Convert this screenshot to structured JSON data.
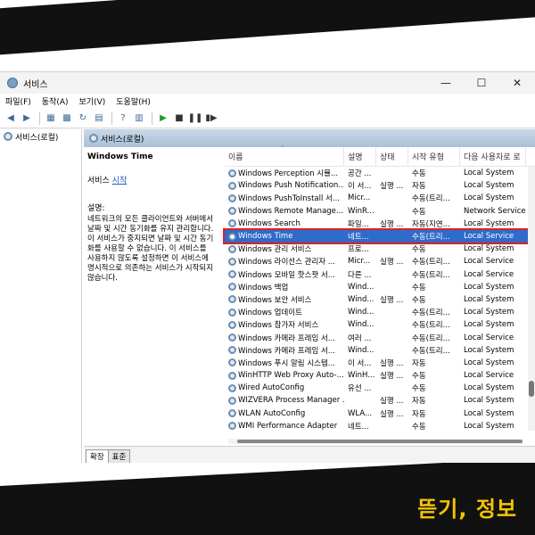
{
  "window": {
    "title": "서비스"
  },
  "menu": [
    "파일(F)",
    "동작(A)",
    "보기(V)",
    "도움말(H)"
  ],
  "tree": {
    "root": "서비스(로컬)"
  },
  "main": {
    "header": "서비스(로컬)"
  },
  "desc": {
    "title": "Windows Time",
    "action_prefix": "서비스 ",
    "action_link": "시작",
    "label": "설명:",
    "body": "네트워크의 모든 클라이언트와 서버에서 날짜 및 시간 동기화를 유지 관리합니다. 이 서비스가 중지되면 날짜 및 시간 동기화를 사용할 수 없습니다. 이 서비스를 사용하지 않도록 설정하면 이 서비스에 명시적으로 의존하는 서비스가 시작되지 않습니다."
  },
  "columns": [
    "이름",
    "설명",
    "상태",
    "시작 유형",
    "다음 사용자로 로"
  ],
  "rows": [
    {
      "name": "Windows Perception 시뮬...",
      "desc": "공간 ...",
      "status": "",
      "start": "수동",
      "logon": "Local System"
    },
    {
      "name": "Windows Push Notification...",
      "desc": "이 서...",
      "status": "실행 ...",
      "start": "자동",
      "logon": "Local System"
    },
    {
      "name": "Windows PushToInstall 서...",
      "desc": "Micr...",
      "status": "",
      "start": "수동(트리...",
      "logon": "Local System"
    },
    {
      "name": "Windows Remote Manage...",
      "desc": "WinR...",
      "status": "",
      "start": "수동",
      "logon": "Network Service"
    },
    {
      "name": "Windows Search",
      "desc": "파일...",
      "status": "실행 ...",
      "start": "자동(지연...",
      "logon": "Local System"
    },
    {
      "name": "Windows Time",
      "desc": "네트...",
      "status": "",
      "start": "수동(트리...",
      "logon": "Local Service",
      "selected": true
    },
    {
      "name": "Windows 관리 서비스",
      "desc": "프로...",
      "status": "",
      "start": "수동",
      "logon": "Local System"
    },
    {
      "name": "Windows 라이선스 관리자 ...",
      "desc": "Micr...",
      "status": "실행 ...",
      "start": "수동(트리...",
      "logon": "Local Service"
    },
    {
      "name": "Windows 모바일 핫스팟 서...",
      "desc": "다른 ...",
      "status": "",
      "start": "수동(트리...",
      "logon": "Local Service"
    },
    {
      "name": "Windows 백업",
      "desc": "Wind...",
      "status": "",
      "start": "수동",
      "logon": "Local System"
    },
    {
      "name": "Windows 보안 서비스",
      "desc": "Wind...",
      "status": "실행 ...",
      "start": "수동",
      "logon": "Local System"
    },
    {
      "name": "Windows 업데이트",
      "desc": "Wind...",
      "status": "",
      "start": "수동(트리...",
      "logon": "Local System"
    },
    {
      "name": "Windows 참가자 서비스",
      "desc": "Wind...",
      "status": "",
      "start": "수동(트리...",
      "logon": "Local System"
    },
    {
      "name": "Windows 카메라 프레임 서...",
      "desc": "여러 ...",
      "status": "",
      "start": "수동(트리...",
      "logon": "Local Service"
    },
    {
      "name": "Windows 카메라 프레임 서...",
      "desc": "Wind...",
      "status": "",
      "start": "수동(트리...",
      "logon": "Local System"
    },
    {
      "name": "Windows 푸시 알림 시스템...",
      "desc": "이 서...",
      "status": "실행 ...",
      "start": "자동",
      "logon": "Local System"
    },
    {
      "name": "WinHTTP Web Proxy Auto-...",
      "desc": "WinH...",
      "status": "실행 ...",
      "start": "수동",
      "logon": "Local Service"
    },
    {
      "name": "Wired AutoConfig",
      "desc": "유선 ...",
      "status": "",
      "start": "수동",
      "logon": "Local System"
    },
    {
      "name": "WIZVERA Process Manager ...",
      "desc": "",
      "status": "실행 ...",
      "start": "자동",
      "logon": "Local System"
    },
    {
      "name": "WLAN AutoConfig",
      "desc": "WLA...",
      "status": "실행 ...",
      "start": "자동",
      "logon": "Local System"
    },
    {
      "name": "WMI Performance Adapter",
      "desc": "네트...",
      "status": "",
      "start": "수동",
      "logon": "Local System"
    }
  ],
  "tabs": [
    "확장",
    "표준"
  ],
  "brand": "뜯기, 정보",
  "colors": {
    "selected": "#2f6bc9",
    "highlight_border": "#e02020",
    "link": "#1e5bbf",
    "brand": "#f5c400"
  }
}
